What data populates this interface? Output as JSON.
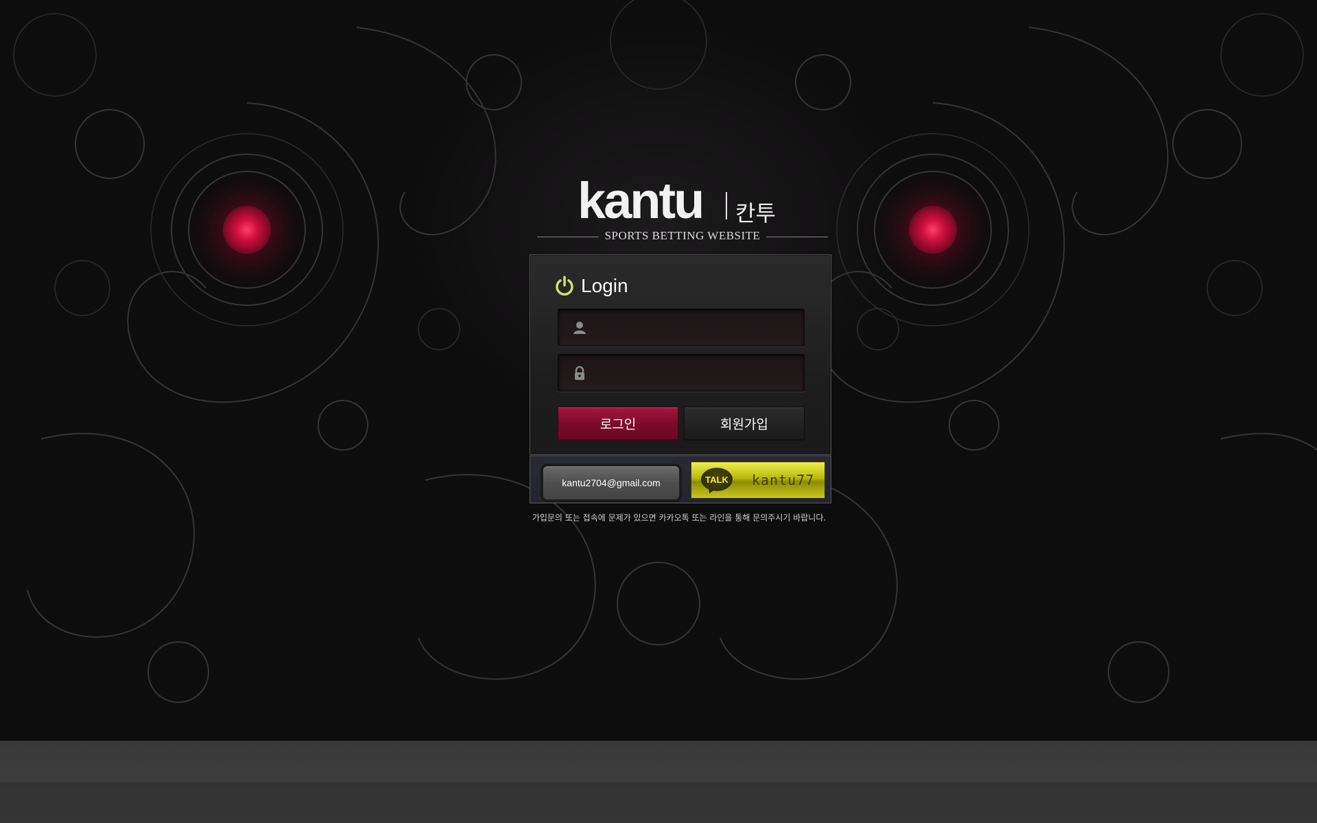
{
  "logo": {
    "brand": "kantu",
    "korean": "칸투",
    "tagline": "SPORTS BETTING WEBSITE"
  },
  "login": {
    "title": "Login",
    "username_placeholder": "",
    "password_placeholder": "",
    "login_button": "로그인",
    "join_button": "회원가입"
  },
  "contact": {
    "email": "kantu2704@gmail.com",
    "talk_badge": "TALK",
    "talk_id": "kantu77"
  },
  "notice": "가입문의 또는 접속에 문제가 있으면 카카오톡 또는 라인을 통해 문의주시기 바랍니다.",
  "colors": {
    "accent_red": "#8a0a2b",
    "talk_yellow": "#d6d41d",
    "power_icon": "#cfe06a"
  },
  "icons": [
    "power-icon",
    "user-icon",
    "lock-icon",
    "talk-icon"
  ]
}
